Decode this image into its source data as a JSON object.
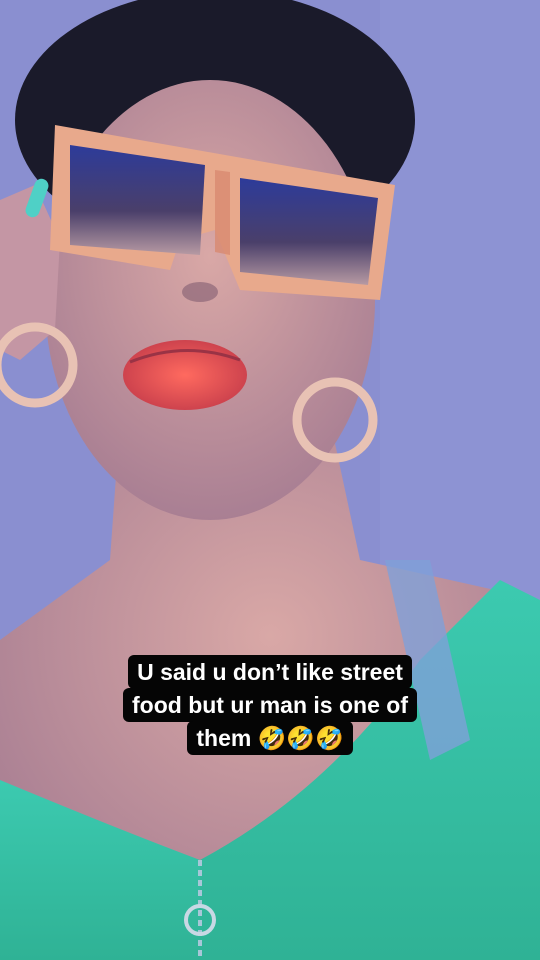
{
  "video": {
    "scene": "selfie-video",
    "caption_lines": [
      "U said u don’t like street",
      "food but ur man is one of",
      "them 🤣🤣🤣"
    ],
    "colors": {
      "background": "#7f86c7",
      "skin": "#c89a9a",
      "top": "#3fbfa0",
      "sunglasses_frame": "#e8a98c",
      "lips": "#e0504e",
      "caption_bg": "#050505",
      "caption_text": "#ffffff"
    }
  }
}
